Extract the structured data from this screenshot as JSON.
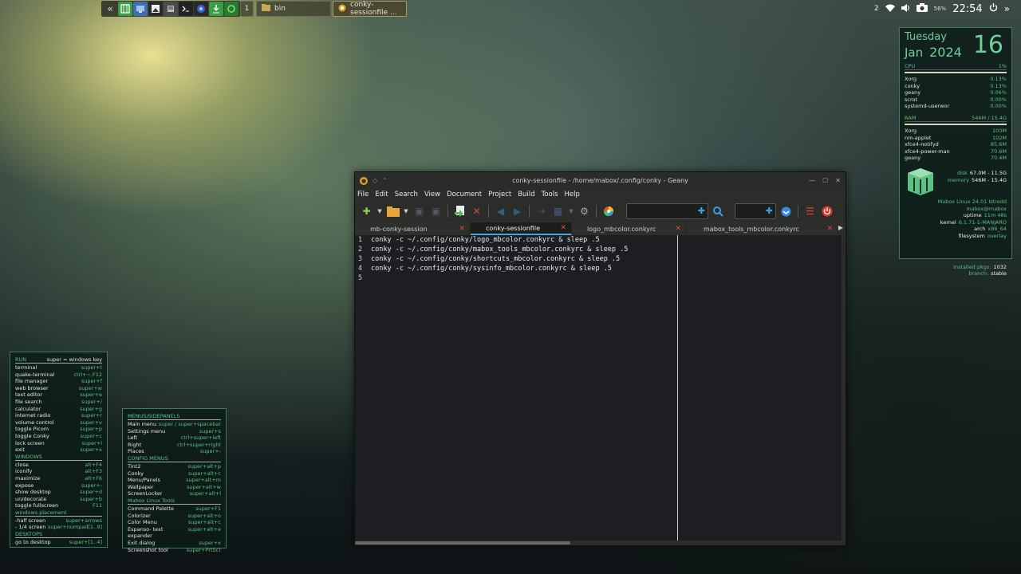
{
  "taskbar": {
    "collapse_label": "«",
    "workspace_label": "1",
    "launcher_icons": [
      "spreadsheet-icon",
      "monitor-icon",
      "image-viewer-icon",
      "text-editor-icon",
      "terminal-icon",
      "browser-icon",
      "download-manager-icon",
      "refresh-icon"
    ],
    "tasks": [
      {
        "label": "bin",
        "icon": "folder-icon"
      },
      {
        "label": "conky-sessionfile ...",
        "icon": "geany-icon"
      }
    ]
  },
  "tray": {
    "notification_count": "2",
    "battery": "56%",
    "time": "22:54",
    "more": "»"
  },
  "sysinfo": {
    "day": "Tuesday",
    "month": "Jan",
    "year": "2024",
    "date": "16",
    "cpu": {
      "label": "CPU",
      "value": "1%",
      "usage_fraction": 0.01,
      "procs": [
        {
          "name": "Xorg",
          "val": "0.13%"
        },
        {
          "name": "conky",
          "val": "0.13%"
        },
        {
          "name": "geany",
          "val": "0.06%"
        },
        {
          "name": "scrot",
          "val": "0.00%"
        },
        {
          "name": "systemd-userwor",
          "val": "0.00%"
        }
      ]
    },
    "ram": {
      "label": "RAM",
      "value": "546M / 15.4G",
      "usage_fraction": 0.035,
      "procs": [
        {
          "name": "Xorg",
          "val": "103M"
        },
        {
          "name": "nm-applet",
          "val": "102M"
        },
        {
          "name": "xfce4-notifyd",
          "val": "85.6M"
        },
        {
          "name": "xfce4-power-man",
          "val": "70.6M"
        },
        {
          "name": "geany",
          "val": "70.4M"
        }
      ]
    },
    "disk": {
      "label": "disk",
      "value": "67.0M - 11.5G"
    },
    "memory": {
      "label": "memory",
      "value": "546M - 15.4G"
    },
    "distro": "Mabox Linux 24.01 Istredd",
    "host": "mabox@mabox",
    "uptime": {
      "label": "uptime",
      "value": "11m 48s"
    },
    "kernel": {
      "label": "kernel",
      "value": "6.1.71-1-MANJARO"
    },
    "arch": {
      "label": "arch",
      "value": "x86_64"
    },
    "filesystem": {
      "label": "filesystem",
      "value": "overlay"
    },
    "pkgs": {
      "label": "installed pkgs:",
      "value": "1032"
    },
    "branch": {
      "label": "branch:",
      "value": "stable"
    }
  },
  "shortcuts_left": {
    "title": "RUN",
    "title_key": "super = windows key",
    "run": [
      {
        "name": "terminal",
        "key": "super+t"
      },
      {
        "name": "quake-terminal",
        "key": "ctrl+~,F12"
      },
      {
        "name": "file manager",
        "key": "super+f"
      },
      {
        "name": "web browser",
        "key": "super+w"
      },
      {
        "name": "text editor",
        "key": "super+e"
      },
      {
        "name": "file search",
        "key": "super+/"
      },
      {
        "name": "calculator",
        "key": "super+g"
      },
      {
        "name": "internet radio",
        "key": "super+r"
      },
      {
        "name": "volume control",
        "key": "super+v"
      },
      {
        "name": "toggle Picom",
        "key": "super+p"
      },
      {
        "name": "toggle Conky",
        "key": "super+c"
      },
      {
        "name": "lock screen",
        "key": "super+l"
      },
      {
        "name": "exit",
        "key": "super+x"
      }
    ],
    "windows_title": "WINDOWS",
    "windows": [
      {
        "name": "close",
        "key": "alt+F4"
      },
      {
        "name": "iconify",
        "key": "alt+F3"
      },
      {
        "name": "maximize",
        "key": "alt+F6"
      },
      {
        "name": "expose",
        "key": "super+-"
      },
      {
        "name": "show desktop",
        "key": "super+d"
      },
      {
        "name": "un/decorate",
        "key": "super+b"
      },
      {
        "name": "toggle fullscreen",
        "key": "F11"
      }
    ],
    "placement_title": "windows placement",
    "placement": [
      {
        "name": "-half screen",
        "key": "super+arrows"
      },
      {
        "name": "- 1/4 screen",
        "key": "super+numpad[1..9]"
      }
    ],
    "desktops_title": "DESKTOPS",
    "desktops": [
      {
        "name": "go to desktop",
        "key": "super+[1..4]"
      }
    ]
  },
  "shortcuts_menus": {
    "title": "MENUS/SIDEPANELS",
    "menus": [
      {
        "name": "Main menu",
        "key": "super / super+spacebar"
      },
      {
        "name": "Settings menu",
        "key": "super+s"
      },
      {
        "name": "Left",
        "key": "ctrl+super+left"
      },
      {
        "name": "Right",
        "key": "ctrl+super+right"
      },
      {
        "name": "Places",
        "key": "super+-"
      }
    ],
    "config_title": "CONFIG MENUS",
    "config": [
      {
        "name": "Tint2",
        "key": "super+alt+p"
      },
      {
        "name": "Conky",
        "key": "super+alt+c"
      },
      {
        "name": "Menu/Panels",
        "key": "super+alt+m"
      },
      {
        "name": "Wallpaper",
        "key": "super+alt+w"
      },
      {
        "name": "ScreenLocker",
        "key": "super+alt+l"
      }
    ],
    "tools_title": "Mabox Linux Tools",
    "tools": [
      {
        "name": "Command Palette",
        "key": "super+F1"
      },
      {
        "name": "Colorizer",
        "key": "super+alt+o"
      },
      {
        "name": "Color Menu",
        "key": "super+alt+c"
      },
      {
        "name": "Espanso- text expander",
        "key": "super+alt+e"
      },
      {
        "name": "Exit dialog",
        "key": "super+x"
      },
      {
        "name": "Screenshot tool",
        "key": "super+PrtScr"
      }
    ]
  },
  "geany": {
    "title": "conky-sessionfile - /home/mabox/.config/conky - Geany",
    "menu": [
      "File",
      "Edit",
      "Search",
      "View",
      "Document",
      "Project",
      "Build",
      "Tools",
      "Help"
    ],
    "tabs": [
      {
        "label": "mb-conky-session",
        "active": false
      },
      {
        "label": "conky-sessionfile",
        "active": true
      },
      {
        "label": "logo_mbcolor.conkyrc",
        "active": false
      },
      {
        "label": "mabox_tools_mbcolor.conkyrc",
        "active": false
      }
    ],
    "line_numbers": [
      "1",
      "2",
      "3",
      "4",
      "5"
    ],
    "lines": [
      "conky -c ~/.config/conky/logo_mbcolor.conkyrc & sleep .5",
      "conky -c ~/.config/conky/mabox_tools_mbcolor.conkyrc & sleep .5",
      "conky -c ~/.config/conky/shortcuts_mbcolor.conkyrc & sleep .5",
      "conky -c ~/.config/conky/sysinfo_mbcolor.conkyrc & sleep .5",
      ""
    ],
    "search_placeholder": "",
    "goto_placeholder": ""
  },
  "colors": {
    "accent": "#5fbf84",
    "conky_bg": "#0c1c18",
    "close_red": "#e0473c",
    "geany_orange": "#e3a51b"
  }
}
